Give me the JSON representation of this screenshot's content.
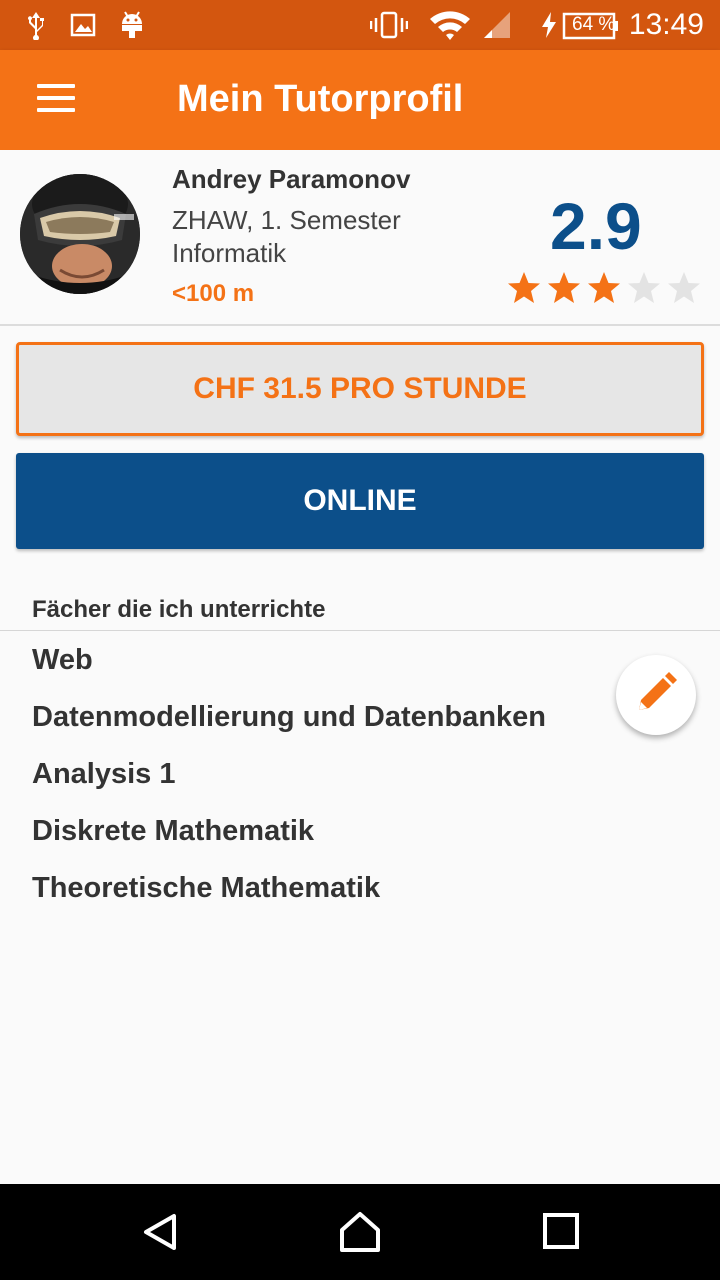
{
  "status_bar": {
    "time": "13:49",
    "battery": "64 %",
    "icons": [
      "usb-icon",
      "image-icon",
      "android-icon",
      "vibrate-icon",
      "wifi-icon",
      "signal-icon",
      "charging-icon",
      "battery-icon"
    ]
  },
  "app_bar": {
    "title": "Mein Tutorprofil",
    "menu_icon": "menu-icon"
  },
  "profile": {
    "name": "Andrey Paramonov",
    "school": "ZHAW, 1. Semester Informatik",
    "distance": "<100 m",
    "rating": "2.9",
    "stars_filled": 3,
    "stars_total": 5
  },
  "buttons": {
    "price": "CHF 31.5 PRO STUNDE",
    "status": "ONLINE"
  },
  "subjects": {
    "header": "Fächer die ich unterrichte",
    "items": [
      "Web",
      "Datenmodellierung und Datenbanken",
      "Analysis 1",
      "Diskrete Mathematik",
      "Theoretische Mathematik"
    ]
  },
  "colors": {
    "accent": "#f47216",
    "status_bar": "#d3560f",
    "primary_blue": "#0c4f8a"
  }
}
